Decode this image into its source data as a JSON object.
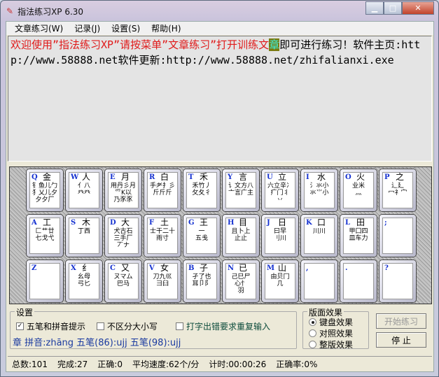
{
  "window": {
    "title": "指法练习XP 6.30"
  },
  "menu": [
    "文章练习(W)",
    "记录(J)",
    "设置(S)",
    "帮助(H)"
  ],
  "text": {
    "red": "欢迎使用”指法练习XP”请按菜单”文章练习”打开训练文",
    "current": "章",
    "rest": "即可进行练习！软件主页:http://www.58888.net软件更新:http://www.58888.net/zhifalianxi.exe"
  },
  "keyboard": {
    "rows": [
      [
        {
          "k": "Q",
          "r": "金",
          "s": "钅鱼儿勹\n犭乂儿夕\n夕夕厂"
        },
        {
          "k": "W",
          "r": "人",
          "s": "亻八\n癶癶"
        },
        {
          "k": "E",
          "r": "月",
          "s": "用丹彡月\n爫K以\n乃豕豕"
        },
        {
          "k": "R",
          "r": "白",
          "s": "手耂扌彡\n斤斤斤"
        },
        {
          "k": "T",
          "r": "禾",
          "s": "禾竹丿\n攵夂彳"
        },
        {
          "k": "Y",
          "r": "言",
          "s": "讠文方八\n亠言广主"
        },
        {
          "k": "U",
          "r": "立",
          "s": "六立辛冫\n疒门丬\n丷"
        },
        {
          "k": "I",
          "r": "水",
          "s": "氵氺小\n氺⺌小"
        },
        {
          "k": "O",
          "r": "火",
          "s": "业米\n灬"
        },
        {
          "k": "P",
          "r": "之",
          "s": "辶廴\n冖礻宀"
        }
      ],
      [
        {
          "k": "A",
          "r": "工",
          "s": "匚艹廿\n七戈弋"
        },
        {
          "k": "S",
          "r": "木",
          "s": "丁西"
        },
        {
          "k": "D",
          "r": "大",
          "s": "犬古石\n三手厂\n丆ナ"
        },
        {
          "k": "F",
          "r": "土",
          "s": "士干二十\n雨寸"
        },
        {
          "k": "G",
          "r": "王",
          "s": "一\n五戋"
        },
        {
          "k": "H",
          "r": "目",
          "s": "且卜上\n止止"
        },
        {
          "k": "J",
          "r": "日",
          "s": "曰早\n刂川"
        },
        {
          "k": "K",
          "r": "口",
          "s": "川川"
        },
        {
          "k": "L",
          "r": "田",
          "s": "甲囗四\n皿车力"
        },
        {
          "k": ";",
          "r": "",
          "s": ""
        }
      ],
      [
        {
          "k": "Z",
          "r": "",
          "s": ""
        },
        {
          "k": "X",
          "r": "纟",
          "s": "幺母\n弓匕"
        },
        {
          "k": "C",
          "r": "又",
          "s": "ㄡマム\n巴马"
        },
        {
          "k": "V",
          "r": "女",
          "s": "刀九巛\n彐臼"
        },
        {
          "k": "B",
          "r": "子",
          "s": "孑了也\n耳卩阝"
        },
        {
          "k": "N",
          "r": "已",
          "s": "己巳尸\n心忄\n羽"
        },
        {
          "k": "M",
          "r": "山",
          "s": "由贝冂\n几"
        },
        {
          "k": ",",
          "r": "",
          "s": ""
        },
        {
          "k": ".",
          "r": "",
          "s": ""
        },
        {
          "k": "?",
          "r": "",
          "s": ""
        }
      ]
    ]
  },
  "settings": {
    "title": "设置",
    "opt1": "五笔和拼音提示",
    "opt1_checked": true,
    "opt2": "不区分大小写",
    "opt2_checked": false,
    "opt3": "打字出错要求重复输入",
    "opt3_checked": false,
    "hint": "章 拼音:zhāng 五笔(86):ujj 五笔(98):ujj"
  },
  "layout_effect": {
    "title": "版面效果",
    "options": [
      "键盘效果",
      "对照效果",
      "整版效果"
    ],
    "selected": "键盘效果"
  },
  "buttons": {
    "start": "开始练习",
    "stop": "停 止"
  },
  "status": {
    "total": "总数:101",
    "done": "完成:27",
    "correct": "正确:0",
    "speed": "平均速度:62个/分",
    "timer": "计时:00:00:26",
    "accuracy": "正确率:0%"
  }
}
